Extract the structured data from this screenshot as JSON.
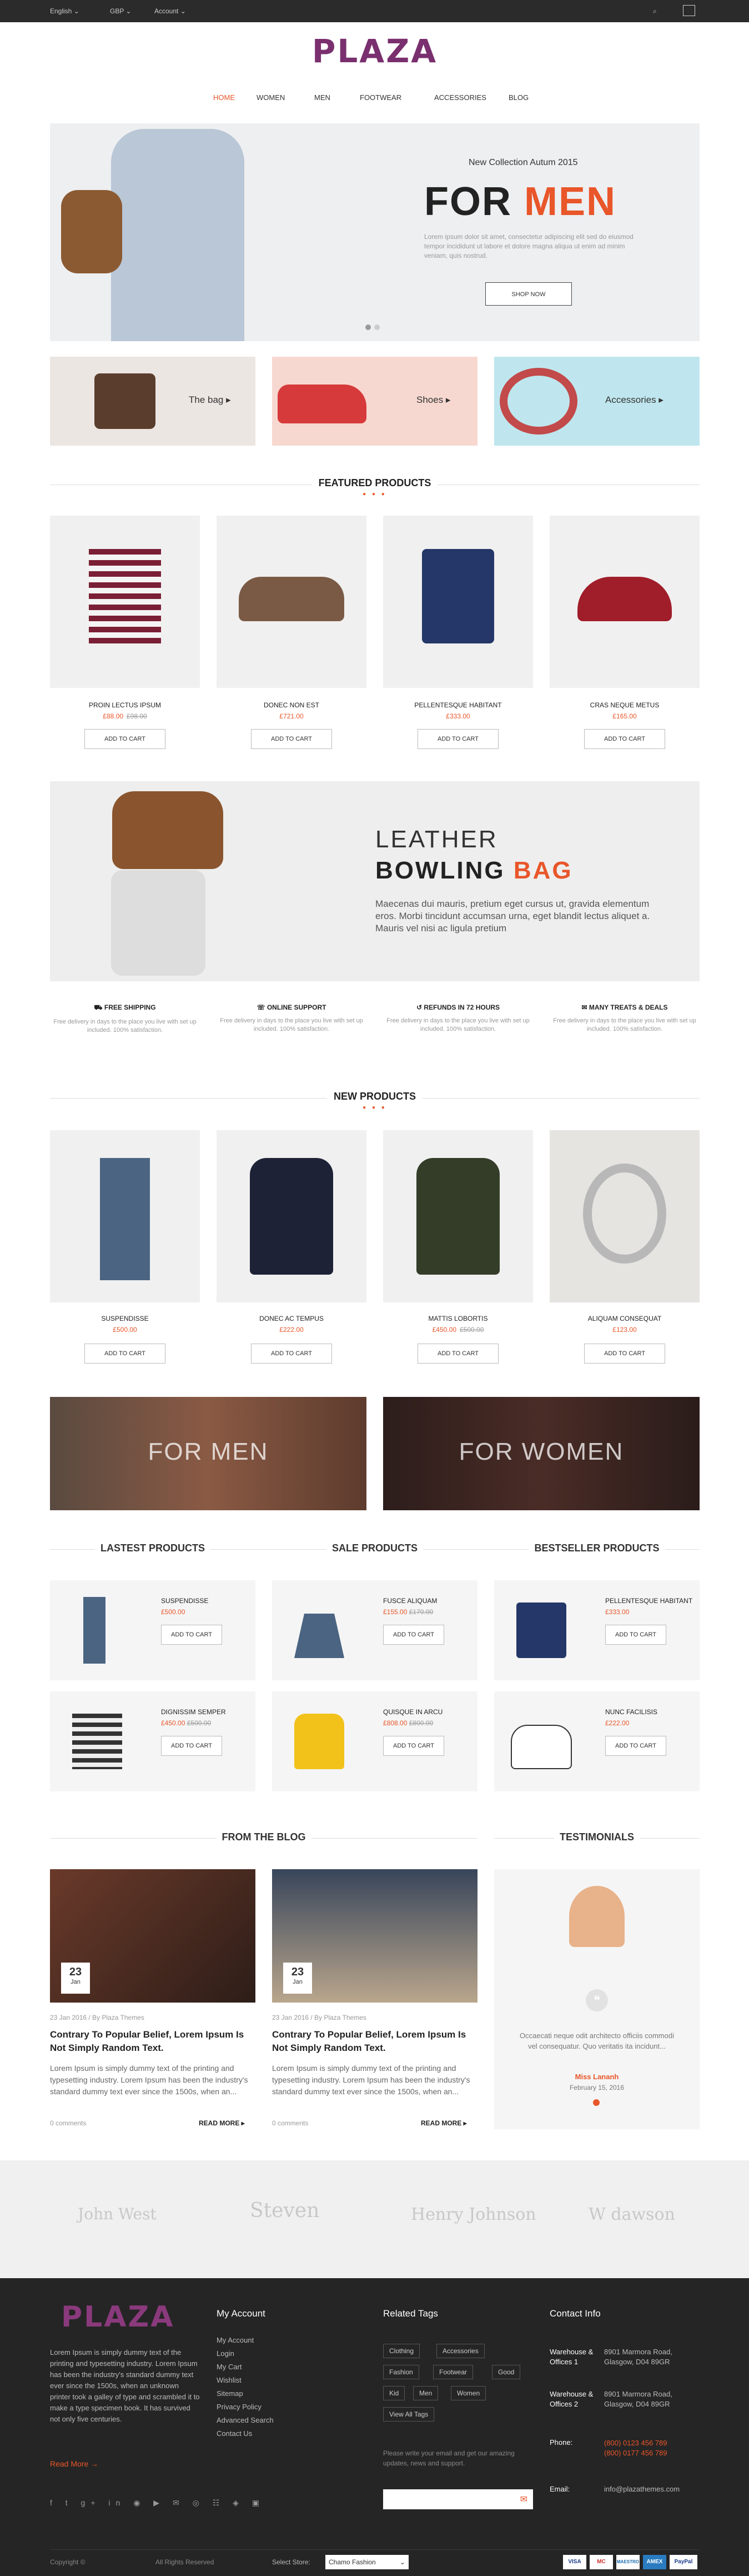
{
  "topbar": {
    "language": "English",
    "currency": "GBP",
    "account": "Account"
  },
  "brand": {
    "logo": "PLAZA",
    "accent": "#e8562a",
    "logo_color": "#7a2f6e"
  },
  "nav": [
    "Home",
    "Women",
    "Men",
    "Footwear",
    "Accessories",
    "Blog"
  ],
  "hero": {
    "subtitle": "New Collection Autum 2015",
    "title_a": "FOR",
    "title_b": "MEN",
    "body": "Lorem ipsum dolor sit amet, consectetur adipiscing elit sed do eiusmod tempor incididunt ut labore et dolore magna aliqua ut enim ad minim veniam, quis nostrud.",
    "button": "SHOP NOW"
  },
  "banners": [
    "The bag",
    "Shoes",
    "Accessories"
  ],
  "featured": {
    "title": "FEATURED PRODUCTS",
    "items": [
      {
        "name": "PROIN LECTUS IPSUM",
        "price": "£88.00",
        "old": "£98.00"
      },
      {
        "name": "DONEC NON EST",
        "price": "£721.00",
        "old": ""
      },
      {
        "name": "PELLENTESQUE HABITANT",
        "price": "£333.00",
        "old": ""
      },
      {
        "name": "CRAS NEQUE METUS",
        "price": "£165.00",
        "old": ""
      }
    ],
    "cart": "ADD TO CART"
  },
  "bowling": {
    "line1": "LEATHER",
    "line2a": "BOWLING",
    "line2b": "BAG",
    "body": "Maecenas dui mauris, pretium eget cursus ut, gravida elementum eros. Morbi tincidunt accumsan urna, eget blandit lectus aliquet a. Mauris vel nisi ac ligula pretium"
  },
  "features": [
    {
      "title": "FREE SHIPPING",
      "desc": "Free delivery in days to the place you live with set up included. 100% satisfaction."
    },
    {
      "title": "ONLINE SUPPORT",
      "desc": "Free delivery in days to the place you live with set up included. 100% satisfaction."
    },
    {
      "title": "REFUNDS IN 72 HOURS",
      "desc": "Free delivery in days to the place you live with set up included. 100% satisfaction."
    },
    {
      "title": "MANY TREATS & DEALS",
      "desc": "Free delivery in days to the place you live with set up included. 100% satisfaction."
    }
  ],
  "newp": {
    "title": "NEW PRODUCTS",
    "items": [
      {
        "name": "SUSPENDISSE",
        "price": "£500.00",
        "old": ""
      },
      {
        "name": "DONEC AC TEMPUS",
        "price": "£222.00",
        "old": ""
      },
      {
        "name": "MATTIS LOBORTIS",
        "price": "£450.00",
        "old": "£500.00"
      },
      {
        "name": "ALIQUAM CONSEQUAT",
        "price": "£123.00",
        "old": ""
      }
    ]
  },
  "promo": [
    "FOR MEN",
    "FOR WOMEN"
  ],
  "lists": [
    {
      "title": "LASTEST PRODUCTS",
      "items": [
        {
          "name": "SUSPENDISSE",
          "price": "£500.00",
          "old": ""
        },
        {
          "name": "DIGNISSIM SEMPER",
          "price": "£450.00",
          "old": "£500.00"
        }
      ]
    },
    {
      "title": "SALE PRODUCTS",
      "items": [
        {
          "name": "FUSCE ALIQUAM",
          "price": "£155.00",
          "old": "£170.00"
        },
        {
          "name": "QUISQUE IN ARCU",
          "price": "£808.00",
          "old": "£800.00"
        }
      ]
    },
    {
      "title": "BESTSELLER PRODUCTS",
      "items": [
        {
          "name": "PELLENTESQUE HABITANT",
          "price": "£333.00",
          "old": ""
        },
        {
          "name": "NUNC FACILISIS",
          "price": "£222.00",
          "old": ""
        }
      ]
    }
  ],
  "blog": {
    "title": "FROM THE BLOG",
    "posts": [
      {
        "day": "23",
        "month": "Jan",
        "meta": "23 Jan 2016 / By Plaza Themes",
        "title": "Contrary To Popular Belief, Lorem Ipsum Is Not Simply Random Text.",
        "text": "Lorem Ipsum is simply dummy text of the printing and typesetting industry. Lorem Ipsum has been the industry's standard dummy text ever since the 1500s, when an...",
        "comments": "0 comments",
        "more": "READ MORE"
      },
      {
        "day": "23",
        "month": "Jan",
        "meta": "23 Jan 2016 / By Plaza Themes",
        "title": "Contrary To Popular Belief, Lorem Ipsum Is Not Simply Random Text.",
        "text": "Lorem Ipsum is simply dummy text of the printing and typesetting industry. Lorem Ipsum has been the industry's standard dummy text ever since the 1500s, when an...",
        "comments": "0 comments",
        "more": "READ MORE"
      }
    ]
  },
  "testimonials": {
    "title": "TESTIMONIALS",
    "quote": "Occaecati neque odit architecto officiis commodi vel consequatur. Quo veritatis ita incidunt...",
    "name": "Miss Lananh",
    "date": "February 15, 2016"
  },
  "brands": [
    "John West",
    "Steven",
    "Henry Johnson",
    "W dawson"
  ],
  "footer": {
    "about": "Lorem Ipsum is simply dummy text of the printing and typesetting industry. Lorem Ipsum has been the industry's standard dummy text ever since the 1500s, when an unknown printer took a galley of type and scrambled it to make a type specimen book. It has survived not only five centuries.",
    "read_more": "Read More",
    "account_title": "My Account",
    "account_links": [
      "My Account",
      "Login",
      "My Cart",
      "Wishlist",
      "Sitemap",
      "Privacy Policy",
      "Advanced Search",
      "Contact Us"
    ],
    "tags_title": "Related Tags",
    "tags": [
      "Clothing",
      "Accessories",
      "Fashion",
      "Footwear",
      "Good",
      "Kid",
      "Men",
      "Women",
      "View All Tags"
    ],
    "newsletter": "Please write your email and get our amazing updates, news and support.",
    "contact_title": "Contact Info",
    "contacts": [
      {
        "label": "Warehouse & Offices 1",
        "value": "8901 Marmora Road, Glasgow, D04 89GR"
      },
      {
        "label": "Warehouse & Offices 2",
        "value": "8901 Marmora Road, Glasgow, D04 89GR"
      },
      {
        "label": "Phone:",
        "value": "(800) 0123 456 789 (800) 0177 456 789"
      },
      {
        "label": "Email:",
        "value": "info@plazathemes.com"
      }
    ],
    "copyright": "Copyright ©",
    "rights": "All Rights Reserved",
    "store_label": "Select Store:",
    "store_value": "Chamo Fashion",
    "payments": [
      "VISA",
      "MC",
      "MAESTRO",
      "AMEX",
      "PayPal"
    ]
  }
}
